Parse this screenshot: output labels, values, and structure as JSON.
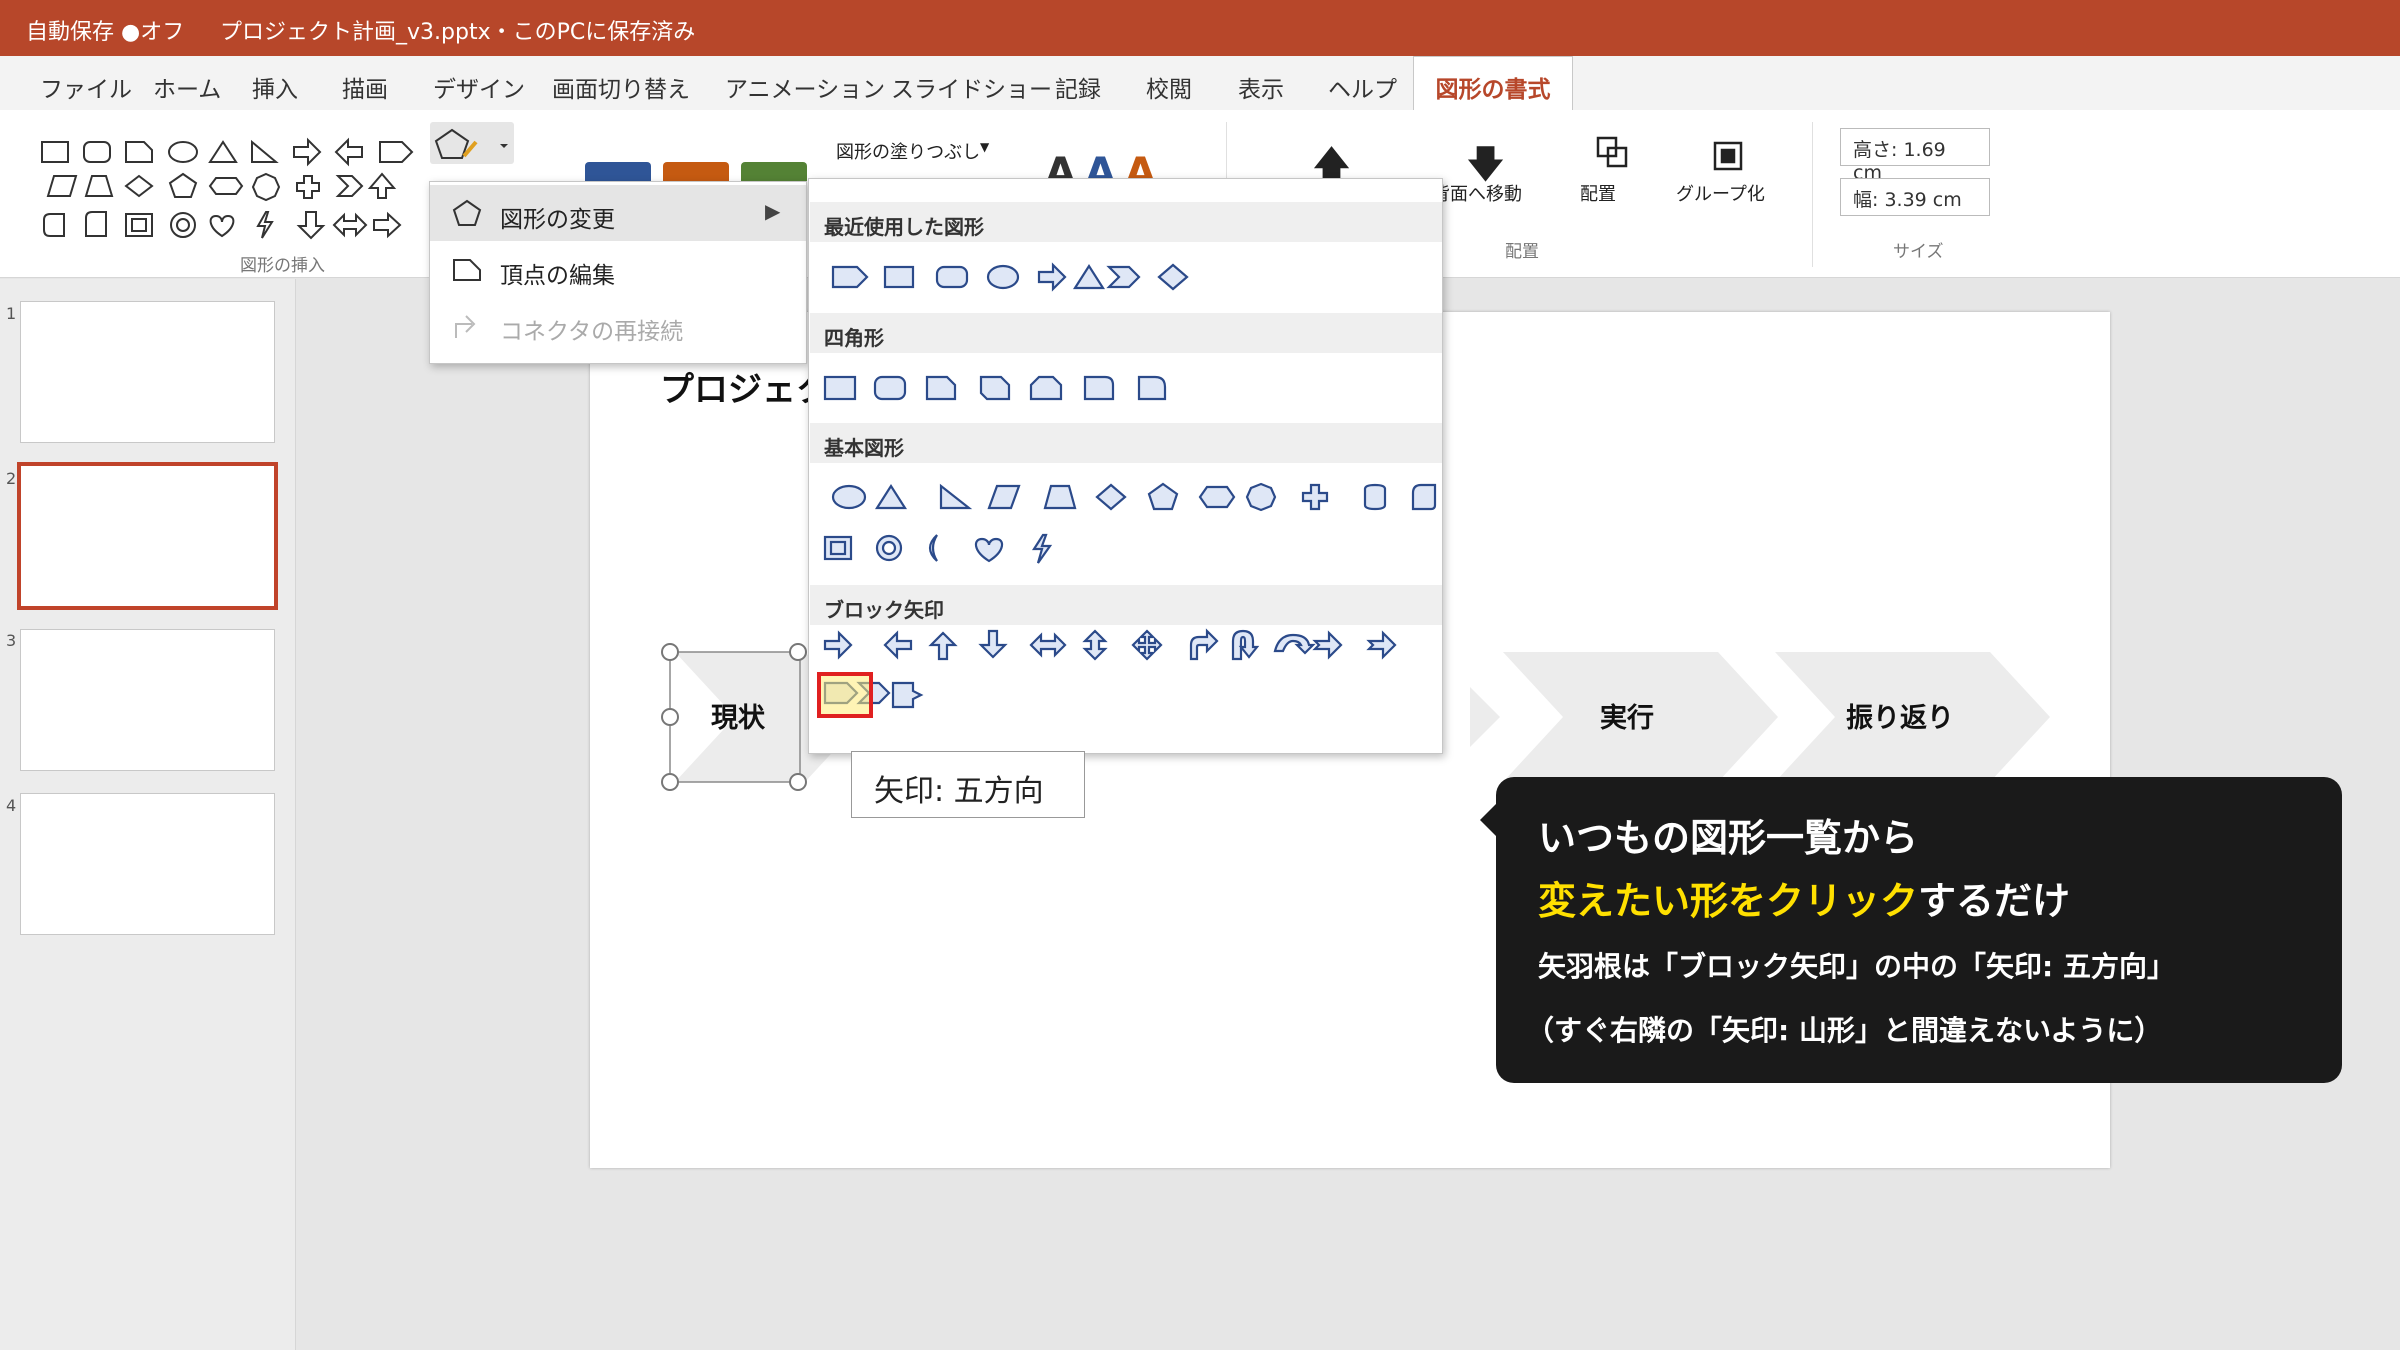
{
  "titlebar": {
    "autosave": "自動保存 ●オフ",
    "doc": "プロジェクト計画_v3.pptx・このPCに保存済み"
  },
  "tabs": [
    "ファイル",
    "ホーム",
    "挿入",
    "描画",
    "デザイン",
    "画面切り替え",
    "アニメーション",
    "スライドショー",
    "記録",
    "校閲",
    "表示",
    "ヘルプ"
  ],
  "active_tab": "図形の書式",
  "ribbon": {
    "insert_group": "図形の挿入",
    "fill": "図形の塗りつぶし",
    "send_back": "背面へ移動",
    "align": "配置",
    "group": "グループ化",
    "arrange_group": "配置",
    "height": "高さ: 1.69 cm",
    "width": "幅: 3.39 cm",
    "size_group": "サイズ",
    "font_sample": "A"
  },
  "submenu": {
    "change": "図形の変更",
    "edit": "頂点の編集",
    "reroute": "コネクタの再接続"
  },
  "gallery": {
    "recent": "最近使用した図形",
    "rect": "四角形",
    "basic": "基本図形",
    "block": "ブロック矢印"
  },
  "slide": {
    "title": "プロジェク",
    "steps": [
      "現状",
      "実行",
      "振り返り"
    ]
  },
  "thumbnails": [
    "1",
    "2",
    "3",
    "4"
  ],
  "tooltip": "矢印: 五方向",
  "callout": {
    "line1": "いつもの図形一覧から",
    "line2_highlight": "変えたい形をクリック",
    "line2_rest": "するだけ",
    "line3": "矢羽根は「ブロック矢印」の中の「矢印: 五方向」",
    "line4": "（すぐ右隣の「矢印: 山形」と間違えないように）"
  },
  "colors": {
    "accent": "#b7472a",
    "highlight": "#ffe000",
    "shape_stroke": "#2b4a8a",
    "shape_fill": "#dfe7f6"
  }
}
